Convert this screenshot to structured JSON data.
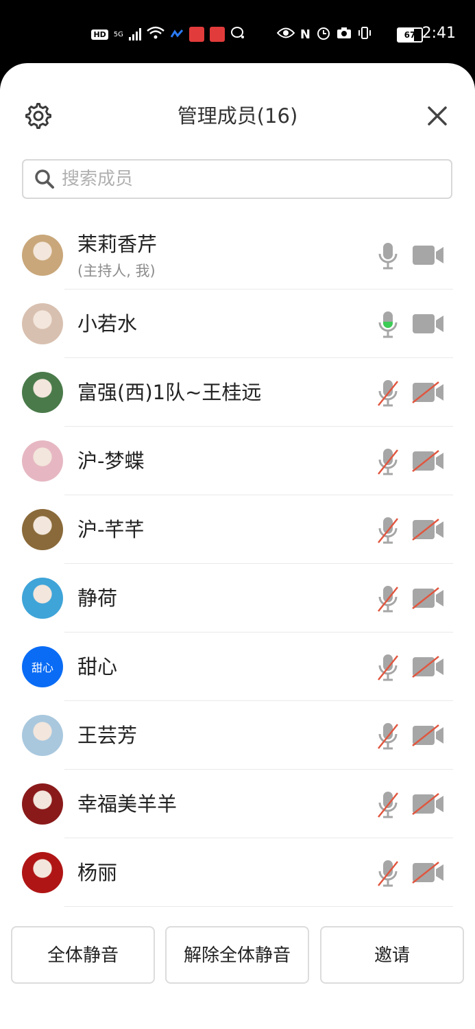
{
  "status_bar": {
    "time": "2:41",
    "battery": "67",
    "battery_level": 0.67,
    "network": "5G",
    "hd": "HD"
  },
  "header": {
    "title": "管理成员(16)"
  },
  "search": {
    "placeholder": "搜索成员"
  },
  "members": [
    {
      "name": "茉莉香芹",
      "subtitle": "(主持人, 我)",
      "mic": "on",
      "camera": "on",
      "avatar_color": "#c9a77a"
    },
    {
      "name": "小若水",
      "subtitle": "",
      "mic": "speaking",
      "camera": "on",
      "avatar_color": "#d8c0b0"
    },
    {
      "name": "富强(西)1队~王桂远",
      "subtitle": "",
      "mic": "off",
      "camera": "off",
      "avatar_color": "#4a7a4a"
    },
    {
      "name": "沪-梦蝶",
      "subtitle": "",
      "mic": "off",
      "camera": "off",
      "avatar_color": "#e6b7c2"
    },
    {
      "name": "沪-芊芊",
      "subtitle": "",
      "mic": "off",
      "camera": "off",
      "avatar_color": "#8a6a3a"
    },
    {
      "name": "静荷",
      "subtitle": "",
      "mic": "off",
      "camera": "off",
      "avatar_color": "#3fa4d8"
    },
    {
      "name": "甜心",
      "subtitle": "",
      "mic": "off",
      "camera": "off",
      "avatar_color": "#0a6cf5",
      "avatar_text": "甜心"
    },
    {
      "name": "王芸芳",
      "subtitle": "",
      "mic": "off",
      "camera": "off",
      "avatar_color": "#a9c8de"
    },
    {
      "name": "幸福美羊羊",
      "subtitle": "",
      "mic": "off",
      "camera": "off",
      "avatar_color": "#8a1a1a"
    },
    {
      "name": "杨丽",
      "subtitle": "",
      "mic": "off",
      "camera": "off",
      "avatar_color": "#b01515"
    }
  ],
  "footer": {
    "mute_all": "全体静音",
    "unmute_all": "解除全体静音",
    "invite": "邀请"
  },
  "colors": {
    "icon_gray": "#a6a6a6",
    "muted_red": "#e0563f",
    "speaking_green": "#3dcc56"
  }
}
